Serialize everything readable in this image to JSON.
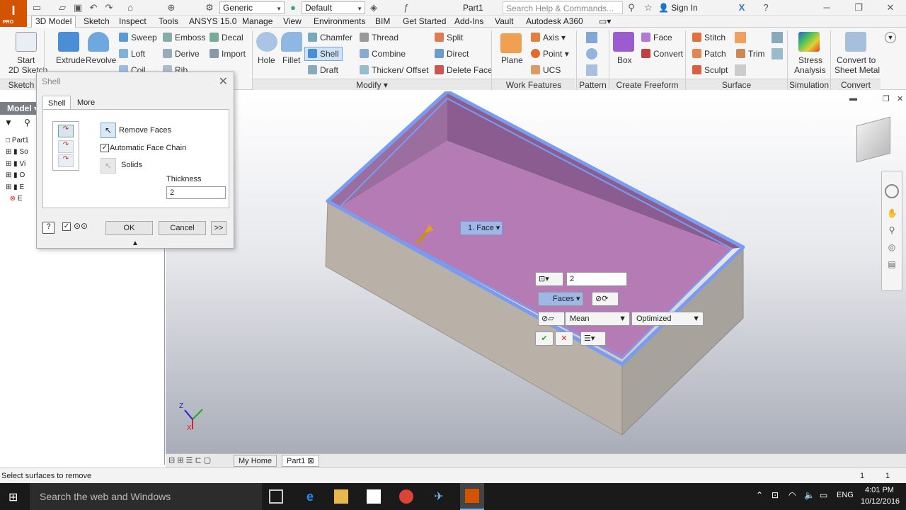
{
  "app": {
    "logo_label": "I",
    "logo_sub": "PRO",
    "doc_title": "Part1",
    "search_placeholder": "Search Help & Commands...",
    "sign_in": "Sign In",
    "material": "Generic",
    "appearance": "Default"
  },
  "menu": {
    "tabs": [
      "3D Model",
      "Sketch",
      "Inspect",
      "Tools",
      "ANSYS 15.0",
      "Manage",
      "View",
      "Environments",
      "BIM",
      "Get Started",
      "Add-Ins",
      "Vault",
      "Autodesk A360"
    ]
  },
  "ribbon": {
    "start_sketch": "Start",
    "start_sketch2": "2D Sketch",
    "extrude": "Extrude",
    "revolve": "Revolve",
    "sweep": "Sweep",
    "loft": "Loft",
    "coil": "Coil",
    "emboss": "Emboss",
    "derive": "Derive",
    "rib": "Rib",
    "decal": "Decal",
    "import": "Import",
    "hole": "Hole",
    "fillet": "Fillet",
    "chamfer": "Chamfer",
    "shell": "Shell",
    "draft": "Draft",
    "thread": "Thread",
    "combine": "Combine",
    "thicken": "Thicken/ Offset",
    "split": "Split",
    "direct": "Direct",
    "delete_face": "Delete Face",
    "plane": "Plane",
    "axis": "Axis",
    "point": "Point",
    "ucs": "UCS",
    "box": "Box",
    "face": "Face",
    "convert": "Convert",
    "stitch": "Stitch",
    "patch": "Patch",
    "trim": "Trim",
    "sculpt": "Sculpt",
    "stress1": "Stress",
    "stress2": "Analysis",
    "sheet1": "Convert to",
    "sheet2": "Sheet Metal",
    "panels": {
      "sketch": "Sketch",
      "modify": "Modify",
      "work": "Work Features",
      "pattern": "Pattern",
      "freeform": "Create Freeform",
      "surface": "Surface",
      "simulation": "Simulation",
      "convert": "Convert"
    }
  },
  "browser": {
    "title": "Model",
    "items": [
      "Part1",
      "So",
      "Vi",
      "O",
      "E",
      "E"
    ]
  },
  "dialog": {
    "title": "Shell",
    "tab_shell": "Shell",
    "tab_more": "More",
    "remove_faces": "Remove Faces",
    "auto_face_chain": "Automatic Face Chain",
    "solids": "Solids",
    "thickness_label": "Thickness",
    "thickness_value": "2",
    "ok": "OK",
    "cancel": "Cancel",
    "more": ">>"
  },
  "viewport": {
    "face_tag": "1. Face",
    "mini_thickness": "2",
    "mini_faces": "Faces",
    "mini_mean": "Mean",
    "mini_optimized": "Optimized"
  },
  "doc_tabs": {
    "home": "My Home",
    "part": "Part1"
  },
  "status": {
    "prompt": "Select surfaces to remove",
    "count1": "1",
    "count2": "1"
  },
  "taskbar": {
    "search": "Search the web and Windows",
    "lang": "ENG",
    "time": "4:01 PM",
    "date": "10/12/2016"
  },
  "colors": {
    "accent": "#d35400",
    "selection_edge": "#7a9cf0",
    "inner_face": "#b57bb4"
  }
}
